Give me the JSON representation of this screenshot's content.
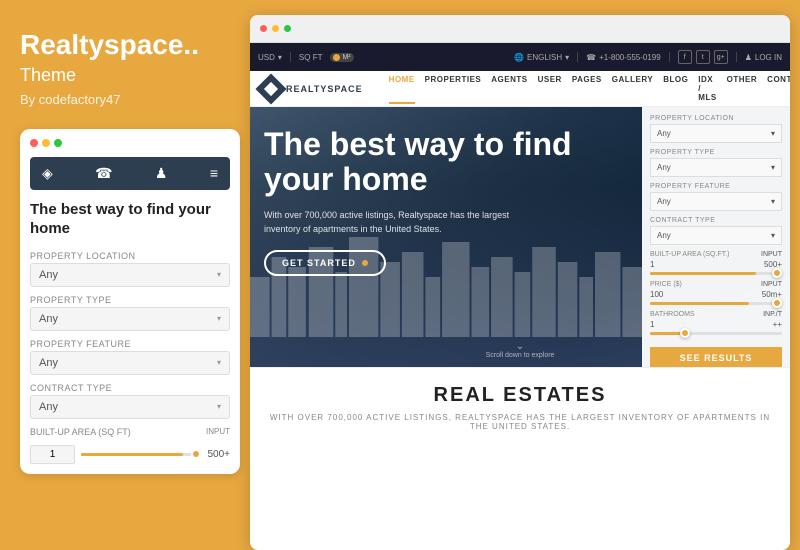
{
  "left": {
    "title": "Realtyspace..",
    "subtitle": "Theme",
    "author": "By codefactory47",
    "mobile": {
      "heading": "The best way to find your home",
      "nav_icons": [
        "◈",
        "☎",
        "♟",
        "≡"
      ],
      "fields": [
        {
          "label": "PROPERTY LOCATION",
          "value": "Any"
        },
        {
          "label": "PROPERTY TYPE",
          "value": "Any"
        },
        {
          "label": "PROPERTY FEATURE",
          "value": "Any"
        },
        {
          "label": "CONTRACT TYPE",
          "value": "Any"
        }
      ],
      "area_label": "BUILT-UP AREA (SQ FT)",
      "area_min": "1",
      "area_max": "500+"
    }
  },
  "right": {
    "browser_dots": [
      "red",
      "yellow",
      "green"
    ],
    "topbar": {
      "currency": "USD",
      "unit": "SQ FT",
      "toggle": "M²",
      "language": "ENGLISH",
      "phone": "+1-800-555-0199",
      "login": "LOG IN"
    },
    "nav": {
      "logo_text": "REALTYSPACE",
      "items": [
        "HOME",
        "PROPERTIES",
        "AGENTS",
        "USER",
        "PAGES",
        "GALLERY",
        "BLOG",
        "IDX / MLS",
        "OTHER",
        "CONTACT"
      ]
    },
    "hero": {
      "title": "The best way to find your home",
      "description": "With over 700,000 active listings, Realtyspace has the largest inventory of apartments in the United States.",
      "cta": "GET STARTED",
      "scroll_text": "Scroll down to explore"
    },
    "search": {
      "fields": [
        {
          "label": "PROPERTY LOCATION",
          "value": "Any"
        },
        {
          "label": "PROPERTY TYPE",
          "value": "Any"
        },
        {
          "label": "PROPERTY FEATURE",
          "value": "Any"
        },
        {
          "label": "CONTRACT TYPE",
          "value": "Any"
        }
      ],
      "area_label": "BUILT-UP AREA (SQ.FT.)",
      "area_min": "1",
      "area_max_label": "INPUT",
      "area_max": "500+",
      "price_label": "PRICE ($)",
      "price_min": "100",
      "price_max_label": "INPUT",
      "price_max": "50m+",
      "baths_label": "BATHROOMS",
      "baths_min": "1",
      "baths_max_label": "INP./T",
      "baths_max": "++",
      "see_results": "SEE RESULTS"
    },
    "bottom": {
      "title": "REAL ESTATES",
      "description": "WITH OVER 700,000 ACTIVE LISTINGS, REALTYSPACE HAS THE LARGEST INVENTORY OF APARTMENTS IN THE UNITED STATES."
    }
  }
}
